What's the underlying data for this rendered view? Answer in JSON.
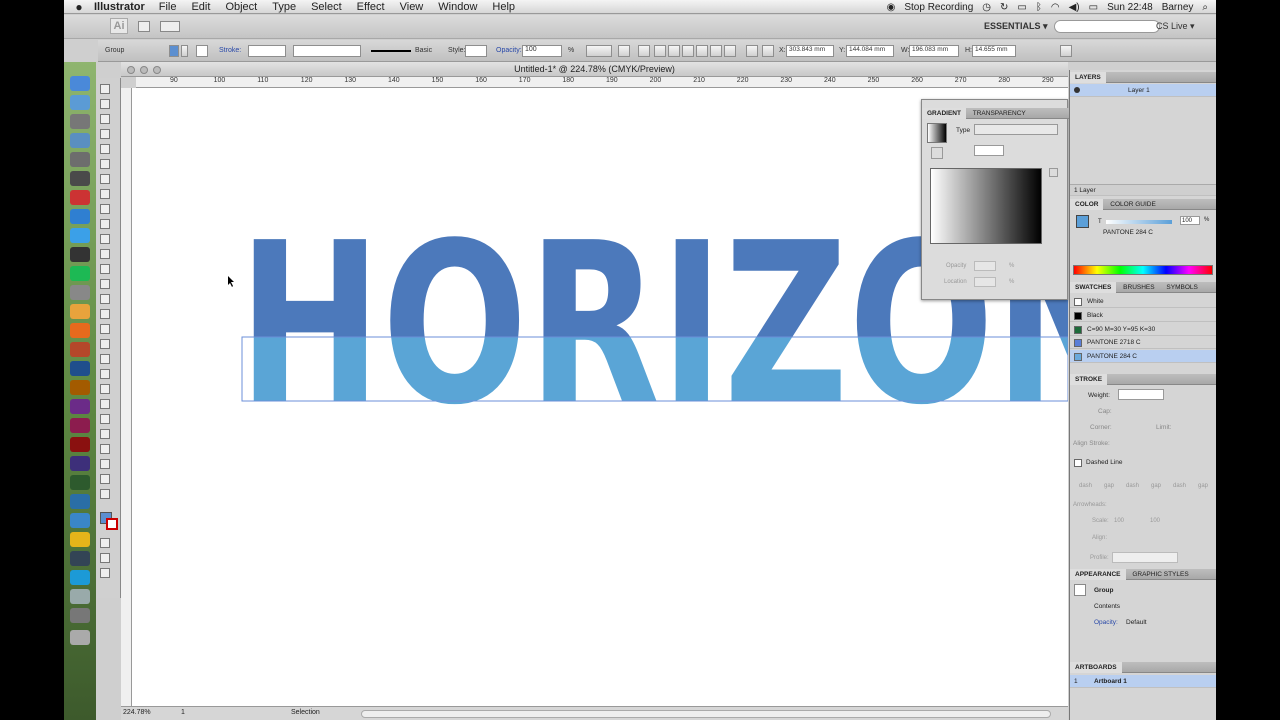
{
  "menubar": {
    "app": "Illustrator",
    "items": [
      "File",
      "Edit",
      "Object",
      "Type",
      "Select",
      "Effect",
      "View",
      "Window",
      "Help"
    ],
    "stop_recording": "Stop Recording",
    "clock": "Sun 22:48",
    "user": "Barney"
  },
  "appbar": {
    "logo": "Ai",
    "workspace": "ESSENTIALS ▾",
    "cslive": "CS Live ▾"
  },
  "control": {
    "selection": "Group",
    "stroke_label": "Stroke:",
    "brush": "Basic",
    "style_label": "Style:",
    "opacity_label": "Opacity:",
    "opacity_value": "100",
    "percent": "%",
    "x_label": "X:",
    "x_value": "303.843 mm",
    "y_label": "Y:",
    "y_value": "144.084 mm",
    "w_label": "W:",
    "w_value": "196.083 mm",
    "h_label": "H:",
    "h_value": "14.655 mm"
  },
  "document": {
    "title": "Untitled-1* @ 224.78% (CMYK/Preview)",
    "ruler_ticks": [
      "90",
      "100",
      "110",
      "120",
      "130",
      "140",
      "150",
      "160",
      "170",
      "180",
      "190",
      "200",
      "210",
      "220",
      "230",
      "240",
      "250",
      "260",
      "270",
      "280",
      "290"
    ],
    "artwork_text": "HORIZON",
    "colors": {
      "top": "#4c79bb",
      "bottom": "#5aa5d6"
    }
  },
  "status": {
    "zoom": "224.78%",
    "page": "1",
    "tool": "Selection"
  },
  "gradient_panel": {
    "tabs": [
      "GRADIENT",
      "TRANSPARENCY"
    ],
    "type_label": "Type",
    "opacity_label": "Opacity",
    "location_label": "Location",
    "percent": "%"
  },
  "layers": {
    "tab": "LAYERS",
    "layer_name": "Layer 1",
    "count": "1 Layer"
  },
  "color": {
    "tabs": [
      "COLOR",
      "COLOR GUIDE"
    ],
    "swatch_name": "PANTONE 284 C",
    "tint_label": "T",
    "tint_value": "100",
    "percent": "%"
  },
  "swatches": {
    "tabs": [
      "SWATCHES",
      "BRUSHES",
      "SYMBOLS"
    ],
    "items": [
      {
        "name": "White",
        "color": "#ffffff"
      },
      {
        "name": "Black",
        "color": "#000000"
      },
      {
        "name": "C=90 M=30 Y=95 K=30",
        "color": "#1e6b3a"
      },
      {
        "name": "PANTONE 2718 C",
        "color": "#5b7fd8"
      },
      {
        "name": "PANTONE 284 C",
        "color": "#6aa9dc"
      }
    ]
  },
  "stroke": {
    "tab": "STROKE",
    "weight": "Weight:",
    "cap": "Cap:",
    "corner": "Corner:",
    "limit": "Limit:",
    "align": "Align Stroke:",
    "dashed": "Dashed Line",
    "dash_labels": [
      "dash",
      "gap",
      "dash",
      "gap",
      "dash",
      "gap"
    ],
    "arrowheads": "Arrowheads:",
    "scale": "Scale:",
    "scale_v1": "100",
    "scale_v2": "100",
    "align2": "Align:",
    "profile": "Profile:"
  },
  "appearance": {
    "tabs": [
      "APPEARANCE",
      "GRAPHIC STYLES"
    ],
    "group": "Group",
    "contents": "Contents",
    "opacity_label": "Opacity:",
    "opacity_value": "Default"
  },
  "artboards": {
    "tab": "ARTBOARDS",
    "index": "1",
    "name": "Artboard 1"
  }
}
